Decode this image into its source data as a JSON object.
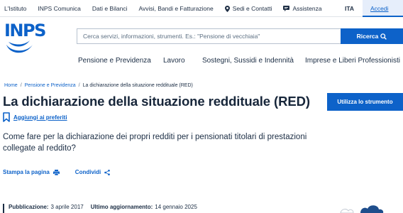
{
  "topbar": {
    "links": [
      "L'Istituto",
      "INPS Comunica",
      "Dati e Bilanci",
      "Avvisi, Bandi e Fatturazione",
      "Sedi e Contatti",
      "Assistenza"
    ],
    "language": "ITA",
    "login_label": "Accedi"
  },
  "header": {
    "logo_text": "INPS",
    "search_placeholder": "Cerca servizi, informazioni, strumenti. Es.: \"Pensione di vecchiaia\"",
    "search_button": "Ricerca"
  },
  "nav": {
    "items": [
      "Pensione e Previdenza",
      "Lavoro",
      "Sostegni, Sussidi e Indennità",
      "Imprese e Liberi Professionisti"
    ]
  },
  "breadcrumb": {
    "items": [
      "Home",
      "Pensione e Previdenza",
      "La dichiarazione della situazione reddituale (RED)"
    ]
  },
  "page": {
    "title": "La dichiarazione della situazione reddituale (RED)",
    "tool_button": "Utilizza lo strumento",
    "favorite_label": "Aggiungi ai preferiti",
    "description": "Come fare per la dichiarazione dei propri redditi per i pensionati titolari di prestazioni collegate al reddito?",
    "print_label": "Stampa la pagina",
    "share_label": "Condividi",
    "publication_label": "Pubblicazione:",
    "publication_date": "3 aprile 2017",
    "update_label": "Ultimo aggiornamento:",
    "update_date": "14 gennaio 2025"
  },
  "colors": {
    "primary": "#0d62c9",
    "text": "#1b2d44",
    "login_bg": "#e6eefb"
  }
}
